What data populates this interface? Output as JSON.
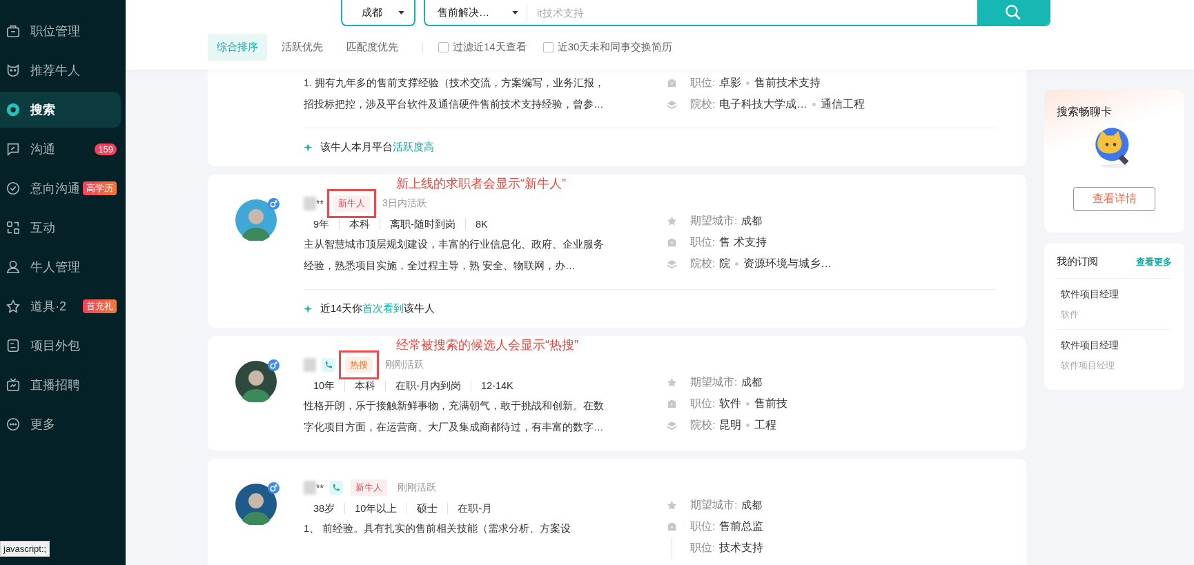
{
  "sidebar": {
    "items": [
      {
        "label": "职位管理",
        "selected": false
      },
      {
        "label": "推荐牛人",
        "selected": false
      },
      {
        "label": "搜索",
        "selected": true
      },
      {
        "label": "沟通",
        "selected": false,
        "badge": {
          "text": "159",
          "kind": "count"
        }
      },
      {
        "label": "意向沟通",
        "selected": false,
        "badge": {
          "text": "高学历",
          "kind": "tag"
        }
      },
      {
        "label": "互动",
        "selected": false
      },
      {
        "label": "牛人管理",
        "selected": false
      },
      {
        "label": "道具·2",
        "selected": false,
        "badge": {
          "text": "首充礼",
          "kind": "tag"
        }
      },
      {
        "label": "项目外包",
        "selected": false
      },
      {
        "label": "直播招聘",
        "selected": false
      },
      {
        "label": "更多",
        "selected": false
      }
    ]
  },
  "search": {
    "city": "成都",
    "position": "售前解决…",
    "placeholder": "it技术支持"
  },
  "sort_tabs": [
    {
      "label": "综合排序",
      "selected": true
    },
    {
      "label": "活跃优先",
      "selected": false
    },
    {
      "label": "匹配度优先",
      "selected": false
    }
  ],
  "filters": [
    {
      "label": "过滤近14天查看",
      "checked": false
    },
    {
      "label": "近30天未和同事交换简历",
      "checked": false
    }
  ],
  "candidates": [
    {
      "description": [
        "1. 拥有九年多的售前支撑经验（技术交流，方案编写，业务汇报，",
        "招投标把控，涉及平台软件及通信硬件售前技术支持经验，曾参…"
      ],
      "details": [
        {
          "kind": "job",
          "label": "职位:",
          "parts": [
            "卓影",
            "售前技术支持"
          ]
        },
        {
          "kind": "school",
          "label": "院校:",
          "parts": [
            "电子科技大学成…",
            "通信工程"
          ]
        }
      ],
      "footer": {
        "prefix": "该牛人本月平台",
        "highlight": "活跃度高"
      }
    },
    {
      "annotation": "新上线的求职者会显示“新牛人”",
      "name": "**",
      "phone": false,
      "tag": {
        "label": "新牛人",
        "kind": "new",
        "boxed": true
      },
      "activity": "3日内活跃",
      "info": [
        "9年",
        "本科",
        "离职-随时到岗",
        "8K"
      ],
      "description": [
        "主从智慧城市顶层规划建设，丰富的行业信息化、政府、企业服务",
        "经验，熟悉项目实施，全过程主导，熟 安全、物联网，办…"
      ],
      "details": [
        {
          "kind": "city",
          "label": "期望城市:",
          "parts": [
            "成都"
          ]
        },
        {
          "kind": "job",
          "label": "职位:",
          "parts": [
            "售 术支持"
          ]
        },
        {
          "kind": "school",
          "label": "院校:",
          "parts": [
            "院",
            "资源环境与城乡…"
          ]
        }
      ],
      "footer": {
        "prefix": "近14天你",
        "highlight": "首次看到",
        "suffix": "该牛人"
      }
    },
    {
      "annotation": "经常被搜索的候选人会显示“热搜”",
      "phone": true,
      "tag": {
        "label": "热搜",
        "kind": "hot",
        "boxed": true
      },
      "activity": "刚刚活跃",
      "info": [
        "10年",
        "本科",
        "在职-月内到岗",
        "12-14K"
      ],
      "description": [
        "性格开朗，乐于接触新鲜事物，充满朝气，敢于挑战和创新。在数",
        "字化项目方面，在运营商、大厂及集成商都待过，有丰富的数字…"
      ],
      "details": [
        {
          "kind": "city",
          "label": "期望城市:",
          "parts": [
            "成都"
          ]
        },
        {
          "kind": "job",
          "label": "职位:",
          "parts": [
            "软件",
            "售前技"
          ]
        },
        {
          "kind": "school",
          "label": "院校:",
          "parts": [
            "昆明",
            "工程"
          ]
        }
      ]
    },
    {
      "name": "**",
      "phone": true,
      "tag": {
        "label": "新牛人",
        "kind": "new",
        "boxed": false
      },
      "activity": "刚刚活跃",
      "info": [
        "38岁",
        "10年以上",
        "硕士",
        "在职-月"
      ],
      "description": [
        "1、 前经验。具有扎实的售前相关技能（需求分析、方案设"
      ],
      "details": [
        {
          "kind": "city",
          "label": "期望城市:",
          "parts": [
            "成都"
          ]
        },
        {
          "kind": "job",
          "label": "职位:",
          "parts": [
            "售前总监"
          ]
        },
        {
          "kind": "job-more",
          "label": "职位:",
          "parts": [
            "技术支持"
          ]
        }
      ]
    }
  ],
  "promo_card": {
    "title": "搜索畅聊卡",
    "button": "查看详情"
  },
  "subscriptions": {
    "title": "我的订阅",
    "more": "查看更多",
    "items": [
      {
        "title": "软件项目经理",
        "subtitle": "软件"
      },
      {
        "title": "软件项目经理",
        "subtitle": "软件项目经理"
      }
    ]
  },
  "status_bar": "javascript:;"
}
